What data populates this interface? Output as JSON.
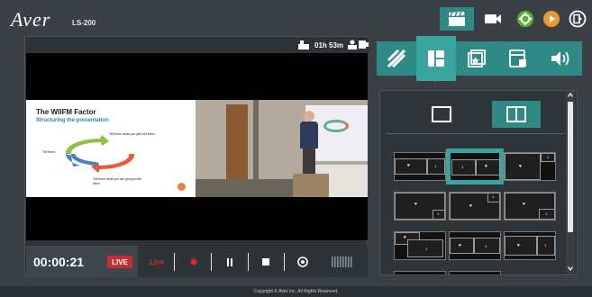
{
  "header": {
    "logo": "Aver",
    "model": "LS-200",
    "nav": [
      "studio-icon",
      "camera-icon",
      "settings-icon",
      "media-icon",
      "exit-icon"
    ],
    "accent": "#2f8a86"
  },
  "preview": {
    "remaining_time": "01h 53m",
    "slide": {
      "title": "The WIIFM Factor",
      "subtitle": "Structuring the presentation",
      "text_1": "Tell them what you just told them",
      "text_2": "Tell them",
      "text_3": "Tell them what you are going to tell them"
    }
  },
  "controls": {
    "record_time": "00:00:21",
    "live_label": "LIVE",
    "live_icon_label": "Live",
    "live_color": "#c52f34"
  },
  "panel": {
    "tabs": [
      "no-signal-icon",
      "layout-icon",
      "overlay-icon",
      "background-icon",
      "audio-icon"
    ],
    "active_tab": "layout-icon",
    "modes": [
      "single-view-icon",
      "split-view-icon"
    ],
    "active_mode": "split-view-icon",
    "layouts": [
      {
        "label_a": "♥",
        "label_b": "1"
      },
      {
        "label_a": "1",
        "label_b": "♥"
      },
      {
        "label_a": "♥",
        "label_b": "1"
      },
      {
        "label_a": "♥",
        "label_b": "1"
      },
      {
        "label_a": "♥",
        "label_b": "1"
      },
      {
        "label_a": "♥",
        "label_b": "1"
      },
      {
        "label_a": "♥",
        "label_b": "1"
      },
      {
        "label_a": "♥",
        "label_b": "1"
      },
      {
        "label_a": "♥",
        "label_b": "1"
      }
    ]
  },
  "footer": {
    "copyright": "Copyright © AVer Inc. All Rights Reserved."
  }
}
